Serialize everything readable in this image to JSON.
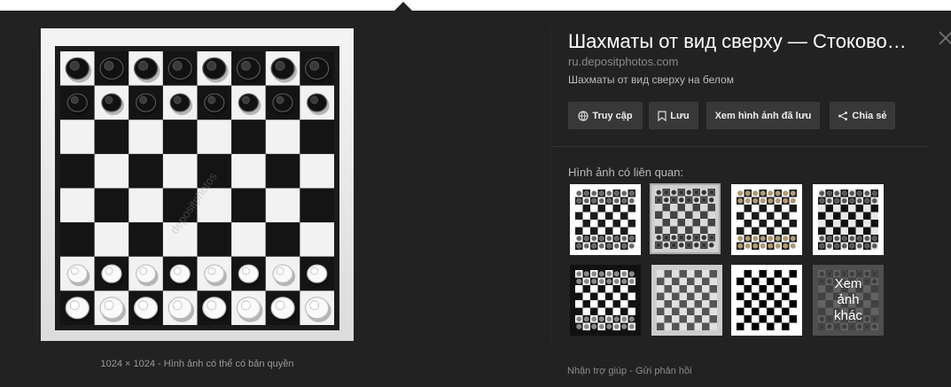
{
  "viewer": {
    "image_size": "1024 × 1024",
    "separator": "-",
    "copyright_note": "Hình ảnh có thể có bản quyền",
    "watermark": "depositphotos"
  },
  "details": {
    "title": "Шахматы от вид сверху — Стоковое фото",
    "domain": "ru.depositphotos.com",
    "description": "Шахматы от вид сверху на белом"
  },
  "actions": {
    "visit": "Truy cập",
    "save": "Lưu",
    "view_saved": "Xem hình ảnh đã lưu",
    "share": "Chia sẻ"
  },
  "related": {
    "label": "Hình ảnh có liên quan:",
    "more_label_lines": [
      "Xem",
      "ảnh",
      "khác"
    ]
  },
  "footer": {
    "help": "Nhận trợ giúp",
    "separator": "-",
    "feedback": "Gửi phản hồi"
  },
  "colors": {
    "panel_bg": "#222222",
    "button_bg": "#383838",
    "text_primary": "#ffffff",
    "text_secondary": "#bbbbbb",
    "text_muted": "#8a8a8a"
  }
}
